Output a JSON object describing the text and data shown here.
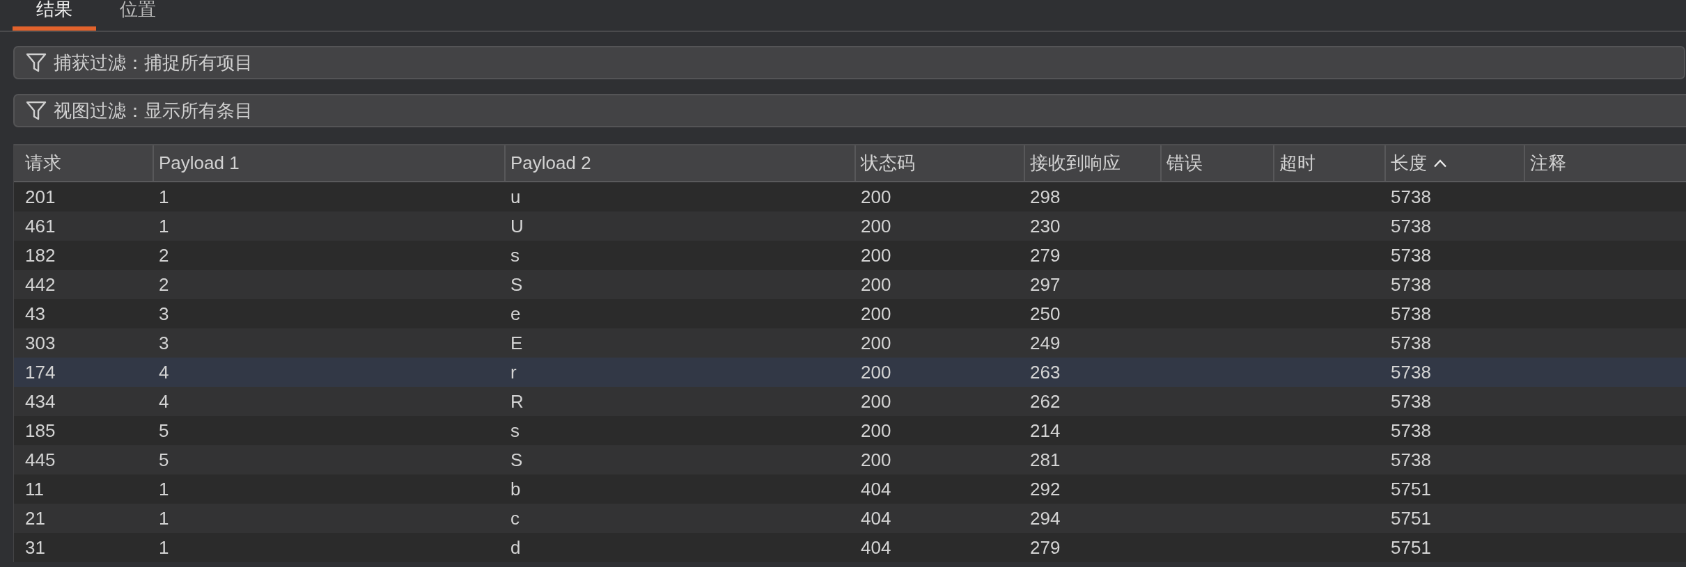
{
  "tabs": [
    {
      "label": "结果",
      "selected": true
    },
    {
      "label": "位置",
      "selected": false
    }
  ],
  "filters": [
    {
      "label": "捕获过滤：捕捉所有项目"
    },
    {
      "label": "视图过滤：显示所有条目"
    }
  ],
  "table": {
    "columns": [
      {
        "label": "请求",
        "sorted": false
      },
      {
        "label": "Payload 1",
        "sorted": false
      },
      {
        "label": "Payload 2",
        "sorted": false
      },
      {
        "label": "状态码",
        "sorted": false
      },
      {
        "label": "接收到响应",
        "sorted": false
      },
      {
        "label": "错误",
        "sorted": false
      },
      {
        "label": "超时",
        "sorted": false
      },
      {
        "label": "长度",
        "sorted": true
      },
      {
        "label": "注释",
        "sorted": false
      }
    ],
    "rows": [
      {
        "request": "201",
        "payload_1": "1",
        "payload_2": "u",
        "status_code": "200",
        "response_received": "298",
        "length": "5738",
        "selected": false
      },
      {
        "request": "461",
        "payload_1": "1",
        "payload_2": "U",
        "status_code": "200",
        "response_received": "230",
        "length": "5738",
        "selected": false
      },
      {
        "request": "182",
        "payload_1": "2",
        "payload_2": "s",
        "status_code": "200",
        "response_received": "279",
        "length": "5738",
        "selected": false
      },
      {
        "request": "442",
        "payload_1": "2",
        "payload_2": "S",
        "status_code": "200",
        "response_received": "297",
        "length": "5738",
        "selected": false
      },
      {
        "request": "43",
        "payload_1": "3",
        "payload_2": "e",
        "status_code": "200",
        "response_received": "250",
        "length": "5738",
        "selected": false
      },
      {
        "request": "303",
        "payload_1": "3",
        "payload_2": "E",
        "status_code": "200",
        "response_received": "249",
        "length": "5738",
        "selected": false
      },
      {
        "request": "174",
        "payload_1": "4",
        "payload_2": "r",
        "status_code": "200",
        "response_received": "263",
        "length": "5738",
        "selected": true
      },
      {
        "request": "434",
        "payload_1": "4",
        "payload_2": "R",
        "status_code": "200",
        "response_received": "262",
        "length": "5738",
        "selected": false
      },
      {
        "request": "185",
        "payload_1": "5",
        "payload_2": "s",
        "status_code": "200",
        "response_received": "214",
        "length": "5738",
        "selected": false
      },
      {
        "request": "445",
        "payload_1": "5",
        "payload_2": "S",
        "status_code": "200",
        "response_received": "281",
        "length": "5738",
        "selected": false
      },
      {
        "request": "11",
        "payload_1": "1",
        "payload_2": "b",
        "status_code": "404",
        "response_received": "292",
        "length": "5751",
        "selected": false
      },
      {
        "request": "21",
        "payload_1": "1",
        "payload_2": "c",
        "status_code": "404",
        "response_received": "294",
        "length": "5751",
        "selected": false
      },
      {
        "request": "31",
        "payload_1": "1",
        "payload_2": "d",
        "status_code": "404",
        "response_received": "279",
        "length": "5751",
        "selected": false
      }
    ]
  }
}
